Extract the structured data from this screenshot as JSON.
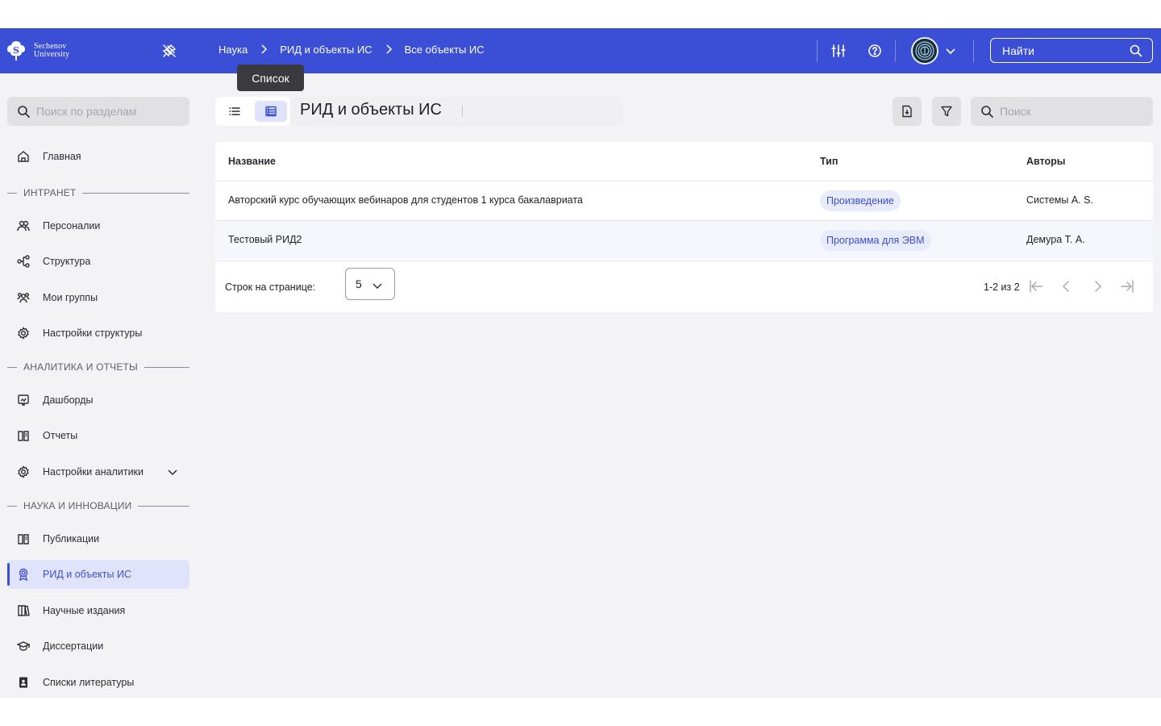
{
  "brand": {
    "line1": "Sechenov",
    "line2": "University"
  },
  "breadcrumbs": [
    "Наука",
    "РИД и объекты ИС",
    "Все объекты ИС"
  ],
  "header": {
    "find_label": "Найти"
  },
  "tooltip": "Список",
  "sidebar": {
    "search_placeholder": "Поиск по разделам",
    "home": "Главная",
    "sections": {
      "intranet": "ИНТРАНЕТ",
      "analytics": "АНАЛИТИКА И ОТЧЕТЫ",
      "science": "НАУКА И ИННОВАЦИИ"
    },
    "items": {
      "personalities": "Персоналии",
      "structure": "Структура",
      "my_groups": "Мои группы",
      "structure_settings": "Настройки структуры",
      "dashboards": "Дашборды",
      "reports": "Отчеты",
      "analytics_settings": "Настройки аналитики",
      "publications": "Публикации",
      "rid": "РИД и объекты ИС",
      "journals": "Научные издания",
      "dissertations": "Диссертации",
      "literature": "Списки литературы"
    }
  },
  "main": {
    "title": "РИД и объекты ИС",
    "search_placeholder": "Поиск",
    "table": {
      "headers": [
        "Название",
        "Тип",
        "Авторы"
      ],
      "rows": [
        {
          "name": "Авторский курс обучающих вебинаров для студентов 1 курса бакалавриата",
          "type": "Произведение",
          "authors": "Системы А. S."
        },
        {
          "name": "Тестовый РИД2",
          "type": "Программа для ЭВМ",
          "authors": "Демура Т. А."
        }
      ]
    },
    "pagination": {
      "rows_per_page_label": "Строк на странице:",
      "rows_per_page": "5",
      "range": "1-2 из 2"
    }
  },
  "colors": {
    "accent": "#3a4fd6",
    "active_bg": "#dfe3fb",
    "chip_bg": "#e8ebfb"
  }
}
